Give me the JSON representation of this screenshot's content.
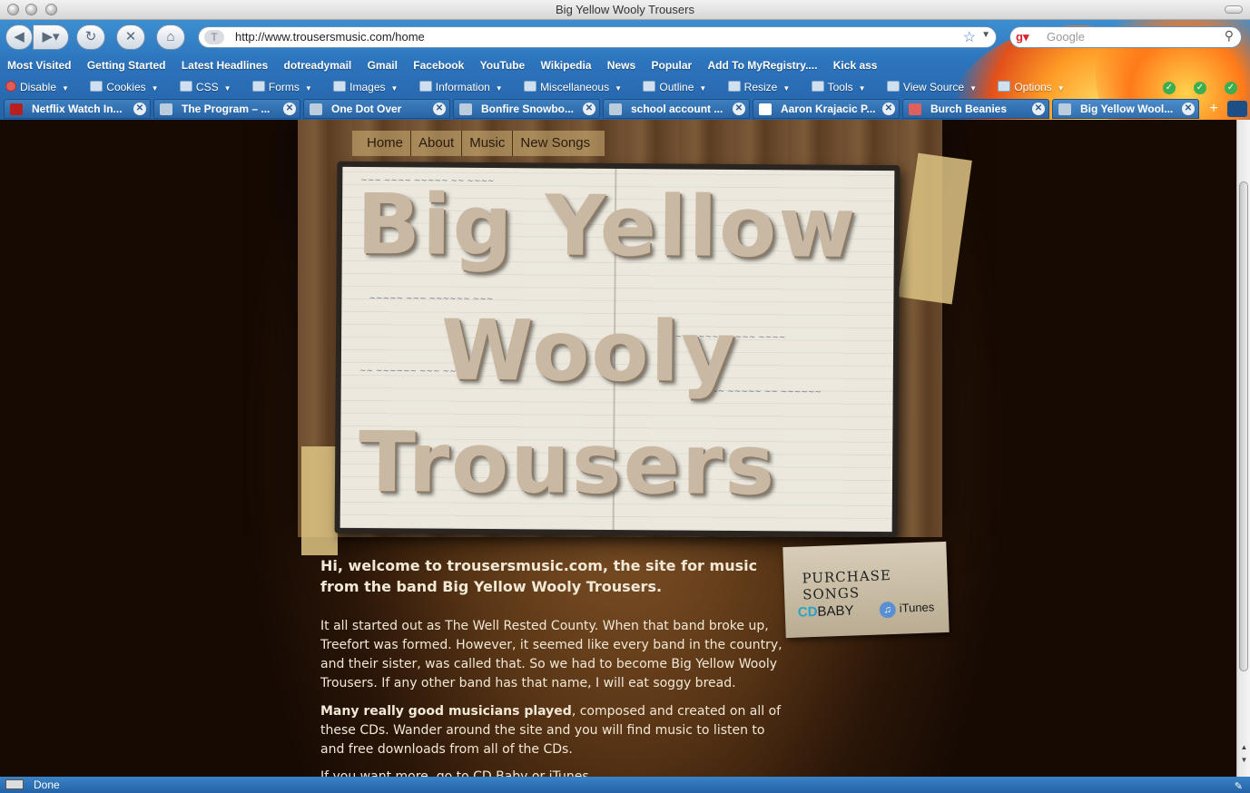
{
  "window": {
    "title": "Big Yellow Wooly Trousers"
  },
  "navbar": {
    "back_icon": "back-arrow-icon",
    "forward_icon": "forward-arrow-icon",
    "reload_icon": "reload-icon",
    "stop_icon": "stop-icon",
    "home_icon": "home-icon",
    "url": "http://www.trousersmusic.com/home",
    "search_placeholder": "Google"
  },
  "bookmarks": [
    "Most Visited",
    "Getting Started",
    "Latest Headlines",
    "dotreadymail",
    "Gmail",
    "Facebook",
    "YouTube",
    "Wikipedia",
    "News",
    "Popular",
    "Add To MyRegistry....",
    "Kick ass"
  ],
  "devbar": [
    "Disable",
    "Cookies",
    "CSS",
    "Forms",
    "Images",
    "Information",
    "Miscellaneous",
    "Outline",
    "Resize",
    "Tools",
    "View Source",
    "Options"
  ],
  "tabs": [
    {
      "label": "Netflix Watch In..."
    },
    {
      "label": "The Program – ..."
    },
    {
      "label": "One Dot Over"
    },
    {
      "label": "Bonfire Snowbo..."
    },
    {
      "label": "school account ..."
    },
    {
      "label": "Aaron Krajacic P..."
    },
    {
      "label": "Burch Beanies"
    },
    {
      "label": "Big Yellow Wool..."
    }
  ],
  "site": {
    "nav": [
      "Home",
      "About",
      "Music",
      "New Songs"
    ],
    "logo": [
      "Big Yellow",
      "Wooly",
      "Trousers"
    ],
    "purchase": {
      "heading": "PURCHASE SONGS",
      "cdbaby_cd": "CD",
      "cdbaby_baby": "BABY",
      "itunes": "iTunes"
    },
    "intro": "Hi, welcome to trousersmusic.com, the site for music from the band Big Yellow Wooly Trousers.",
    "para1": "It all started out as The Well Rested County. When that band broke up, Treefort was formed. However, it seemed like every band in the country, and their sister, was called that. So we had to become Big Yellow Wooly Trousers. If any other band has that name, I will eat soggy bread.",
    "para2_bold": "Many really good musicians played",
    "para2_rest": ", composed and created on all of these CDs. Wander around the site and you will find music to listen to and free downloads from all of the CDs.",
    "para3": "If you want more, go to CD Baby or iTunes."
  },
  "status": {
    "text": "Done"
  }
}
